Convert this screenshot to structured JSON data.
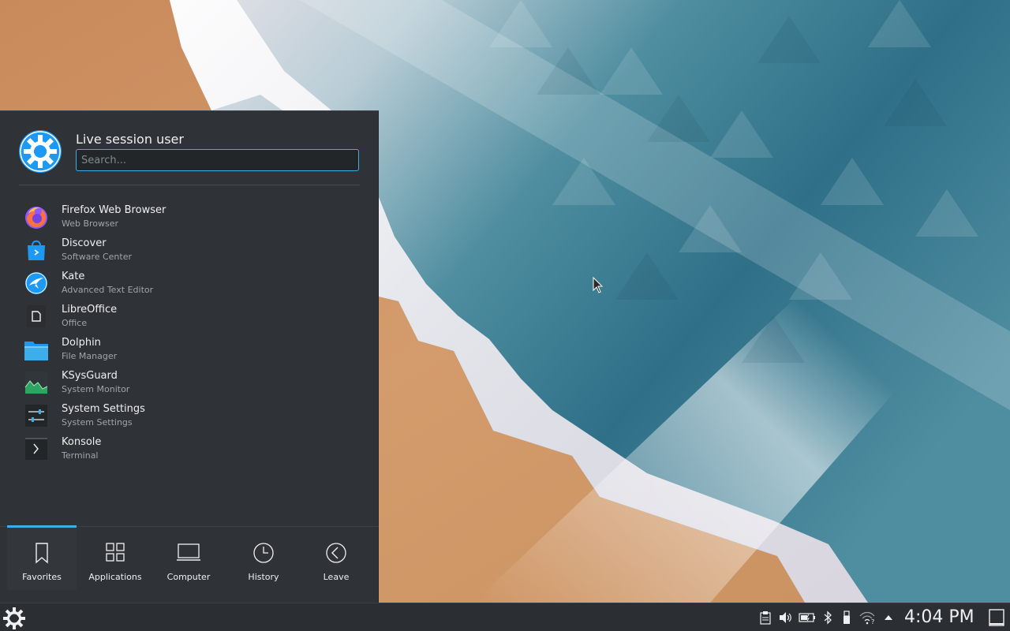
{
  "launcher": {
    "user_name": "Live session user",
    "search_placeholder": "Search...",
    "favorites": [
      {
        "name": "Firefox Web Browser",
        "description": "Web Browser",
        "icon": "firefox-icon"
      },
      {
        "name": "Discover",
        "description": "Software Center",
        "icon": "discover-icon"
      },
      {
        "name": "Kate",
        "description": "Advanced Text Editor",
        "icon": "kate-icon"
      },
      {
        "name": "LibreOffice",
        "description": "Office",
        "icon": "libreoffice-icon"
      },
      {
        "name": "Dolphin",
        "description": "File Manager",
        "icon": "dolphin-icon"
      },
      {
        "name": "KSysGuard",
        "description": "System Monitor",
        "icon": "ksysguard-icon"
      },
      {
        "name": "System Settings",
        "description": "System Settings",
        "icon": "system-settings-icon"
      },
      {
        "name": "Konsole",
        "description": "Terminal",
        "icon": "konsole-icon"
      }
    ],
    "tabs": [
      {
        "label": "Favorites",
        "icon": "bookmark-icon",
        "active": true
      },
      {
        "label": "Applications",
        "icon": "grid-icon",
        "active": false
      },
      {
        "label": "Computer",
        "icon": "laptop-icon",
        "active": false
      },
      {
        "label": "History",
        "icon": "clock-icon",
        "active": false
      },
      {
        "label": "Leave",
        "icon": "back-arrow-icon",
        "active": false
      }
    ]
  },
  "taskbar": {
    "clock": "4:04 PM",
    "tray_icons": [
      "clipboard-icon",
      "volume-icon",
      "battery-icon",
      "bluetooth-icon",
      "usb-device-icon",
      "wifi-icon",
      "expand-tray-icon"
    ]
  },
  "colors": {
    "accent": "#3daee9",
    "panel_bg": "#2f3237",
    "taskbar_bg": "#2b2e32",
    "text": "#eff0f1"
  }
}
